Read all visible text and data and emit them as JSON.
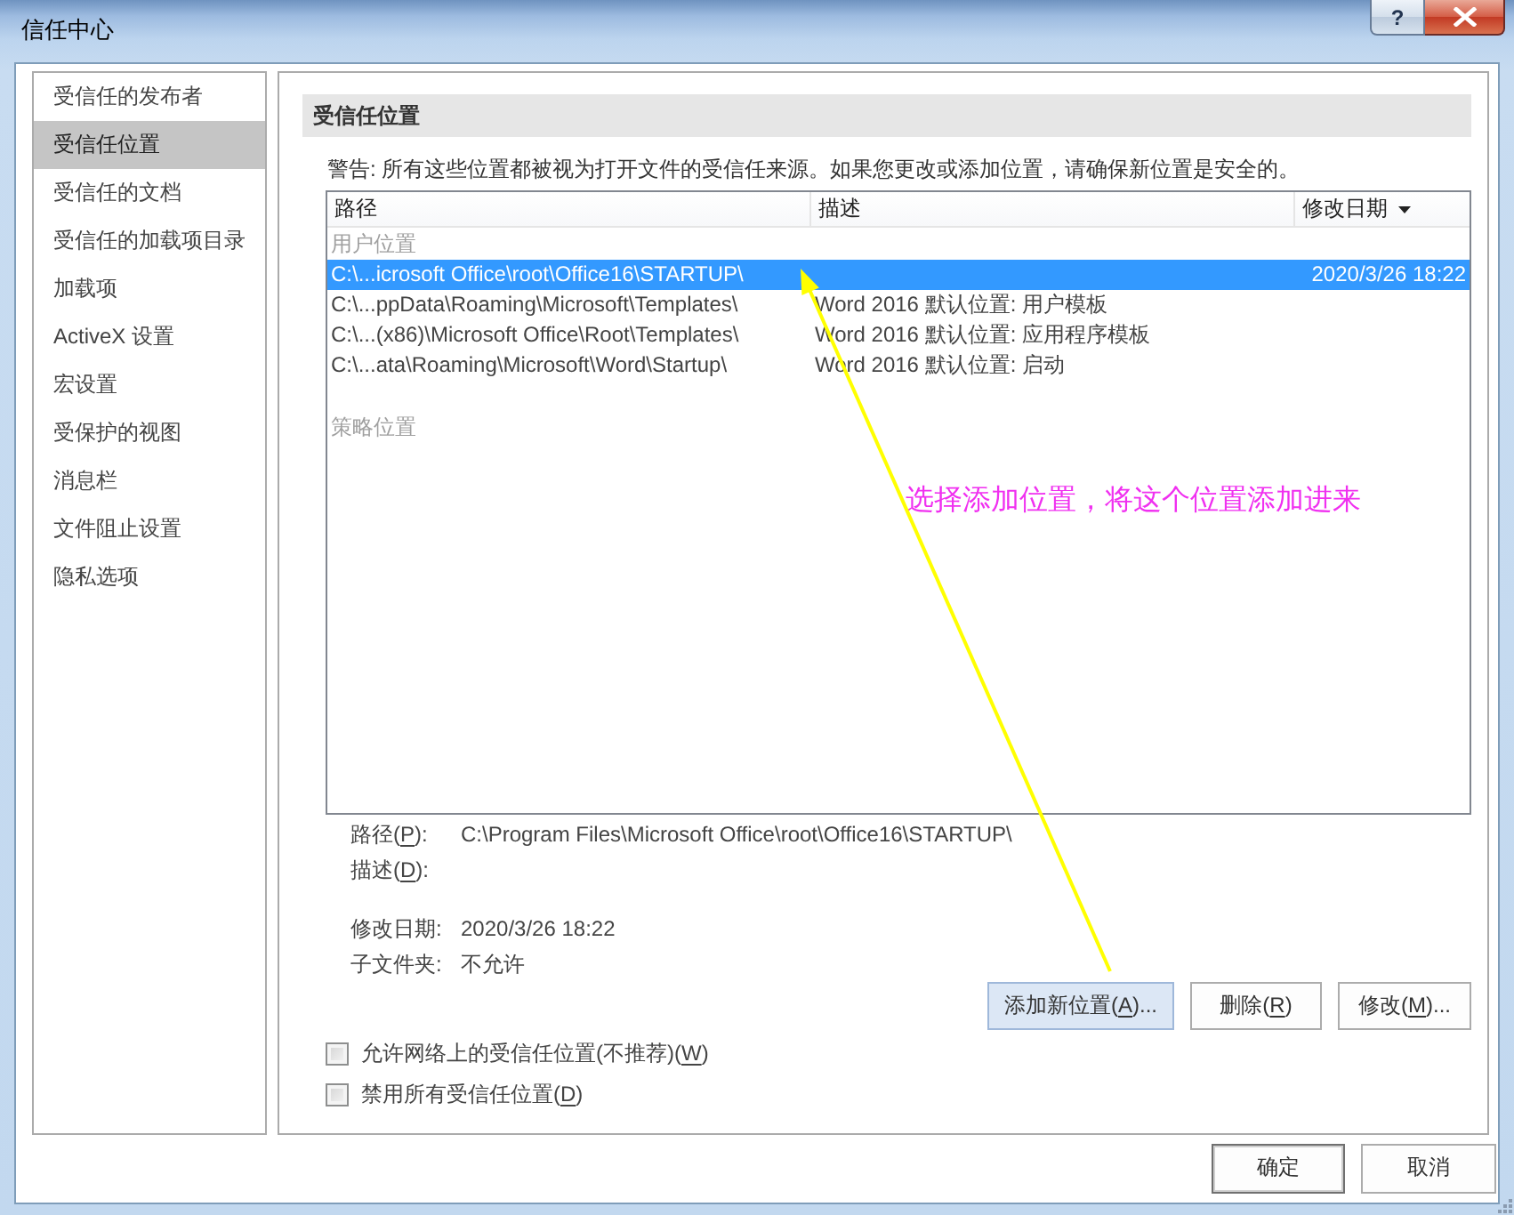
{
  "window": {
    "title": "信任中心",
    "help_button": "?"
  },
  "sidebar": {
    "items": [
      {
        "label": "受信任的发布者",
        "selected": false
      },
      {
        "label": "受信任位置",
        "selected": true
      },
      {
        "label": "受信任的文档",
        "selected": false
      },
      {
        "label": "受信任的加载项目录",
        "selected": false
      },
      {
        "label": "加载项",
        "selected": false
      },
      {
        "label": "ActiveX 设置",
        "selected": false
      },
      {
        "label": "宏设置",
        "selected": false
      },
      {
        "label": "受保护的视图",
        "selected": false
      },
      {
        "label": "消息栏",
        "selected": false
      },
      {
        "label": "文件阻止设置",
        "selected": false
      },
      {
        "label": "隐私选项",
        "selected": false
      }
    ]
  },
  "section": {
    "title": "受信任位置",
    "warning": "警告: 所有这些位置都被视为打开文件的受信任来源。如果您更改或添加位置，请确保新位置是安全的。"
  },
  "table": {
    "columns": [
      {
        "label": "路径",
        "sorted": false
      },
      {
        "label": "描述",
        "sorted": false
      },
      {
        "label": "修改日期",
        "sorted": true
      }
    ],
    "groups": [
      {
        "label": "用户位置",
        "rows": [
          {
            "path": "C:\\...icrosoft Office\\root\\Office16\\STARTUP\\",
            "modified": "2020/3/26 18:22",
            "selected": true
          },
          {
            "path": "C:\\...ppData\\Roaming\\Microsoft\\Templates\\",
            "description": "Word 2016 默认位置: 用户模板",
            "selected": false
          },
          {
            "path": "C:\\...(x86)\\Microsoft Office\\Root\\Templates\\",
            "description": "Word 2016 默认位置: 应用程序模板",
            "selected": false
          },
          {
            "path": "C:\\...ata\\Roaming\\Microsoft\\Word\\Startup\\",
            "description": "Word 2016 默认位置: 启动",
            "selected": false
          }
        ]
      },
      {
        "label": "策略位置"
      }
    ]
  },
  "details": [
    {
      "label": "路径(P):",
      "access_key_underlined": true,
      "value": "C:\\Program Files\\Microsoft Office\\root\\Office16\\STARTUP\\"
    },
    {
      "label": "描述(D):",
      "access_key_underlined": true
    },
    {
      "label": "修改日期:",
      "value": "2020/3/26 18:22"
    },
    {
      "label": "子文件夹:",
      "value": "不允许"
    }
  ],
  "actions": [
    {
      "label": "添加新位置(A)...",
      "access_key_underlined": true,
      "highlighted": true
    },
    {
      "label": "删除(R)",
      "access_key_underlined": true,
      "highlighted": false
    },
    {
      "label": "修改(M)...",
      "access_key_underlined": true,
      "highlighted": false
    }
  ],
  "options": [
    {
      "label": "允许网络上的受信任位置(不推荐)(W)",
      "access_key_underlined": true,
      "checked": false
    },
    {
      "label": "禁用所有受信任位置(D)",
      "access_key_underlined": true,
      "checked": false
    }
  ],
  "annotation": {
    "text": "选择添加位置，将这个位置添加进来"
  },
  "dialog_buttons": [
    {
      "label": "确定",
      "default": true
    },
    {
      "label": "取消",
      "default": false
    }
  ]
}
